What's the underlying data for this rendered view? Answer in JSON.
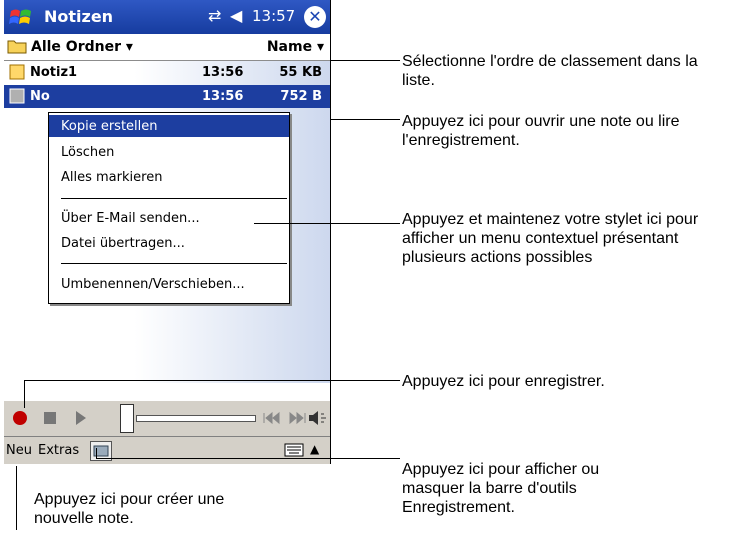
{
  "titlebar": {
    "app_title": "Notizen",
    "clock": "13:57"
  },
  "folderbar": {
    "folder_label": "Alle Ordner",
    "sort_label": "Name"
  },
  "list": {
    "rows": [
      {
        "name": "Notiz1",
        "time": "13:56",
        "size": "55 KB"
      },
      {
        "name": "No",
        "time": "13:56",
        "size": "752 B"
      }
    ]
  },
  "context_menu": {
    "items": [
      "Kopie erstellen",
      "Löschen",
      "Alles markieren",
      "Über E-Mail senden...",
      "Datei übertragen...",
      "Umbenennen/Verschieben..."
    ]
  },
  "cmdbar": {
    "new_label": "Neu",
    "extras_label": "Extras"
  },
  "callouts": {
    "sort": "Sélectionne l'ordre de classement dans la liste.",
    "open": "Appuyez ici pour ouvrir une note ou lire l'enregistrement.",
    "hold": "Appuyez et maintenez votre stylet ici pour afficher un menu contextuel présentant plusieurs actions possibles",
    "record": "Appuyez ici pour enregistrer.",
    "toggle": "Appuyez ici pour afficher ou masquer la barre d'outils Enregistrement.",
    "new": "Appuyez ici pour créer une nouvelle note."
  },
  "colors": {
    "titlebar": "#1d45b0",
    "selection": "#1d3ea0",
    "record_dot": "#c00000"
  }
}
